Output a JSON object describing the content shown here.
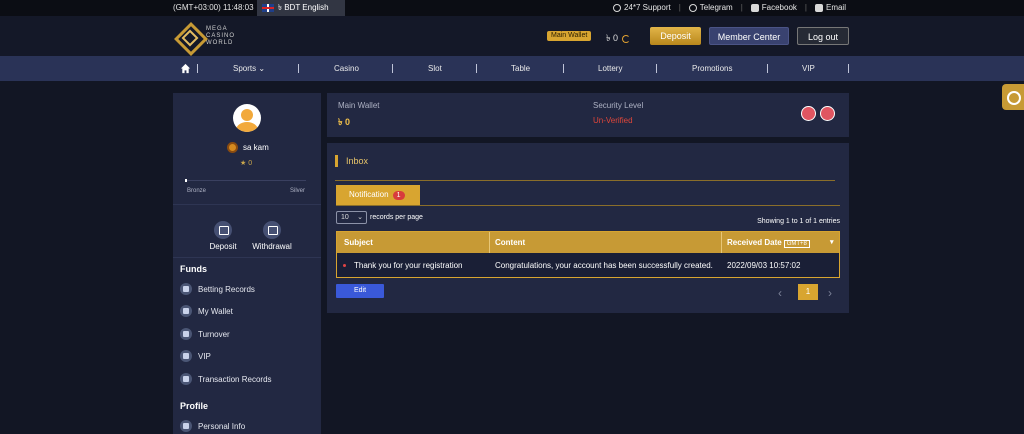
{
  "topbar": {
    "time": "(GMT+03:00) 11:48:03",
    "language": "৳ BDT English",
    "support": "24*7 Support",
    "telegram": "Telegram",
    "facebook": "Facebook",
    "email": "Email"
  },
  "header": {
    "logo_text": "MEGA CASINO WORLD",
    "wallet_label": "Main Wallet",
    "wallet_amount": "৳ 0",
    "deposit": "Deposit",
    "member_center": "Member Center",
    "logout": "Log out"
  },
  "nav": {
    "items": [
      "Sports",
      "Casino",
      "Slot",
      "Table",
      "Lottery",
      "Promotions",
      "VIP"
    ]
  },
  "sidebar": {
    "username": "sa kam",
    "vip_level": "★ 0",
    "level_from": "Bronze",
    "level_to": "Silver",
    "progress": 0.02,
    "deposit": "Deposit",
    "withdrawal": "Withdrawal",
    "funds_title": "Funds",
    "funds_items": [
      "Betting Records",
      "My Wallet",
      "Turnover",
      "VIP",
      "Transaction Records"
    ],
    "profile_title": "Profile",
    "profile_items": [
      "Personal Info"
    ]
  },
  "wallet_card": {
    "main_wallet_label": "Main Wallet",
    "main_wallet_value": "৳ 0",
    "security_label": "Security Level",
    "security_value": "Un-Verified"
  },
  "inbox": {
    "title": "Inbox",
    "tab_label": "Notification",
    "tab_count": "1",
    "rpp_value": "10",
    "rpp_label": "records per page",
    "entries_text": "Showing 1 to 1 of 1 entries",
    "columns": {
      "subject": "Subject",
      "content": "Content",
      "received": "Received Date",
      "gmt": "GMT+8"
    },
    "rows": [
      {
        "subject": "Thank you for your registration",
        "content": "Congratulations, your account has been successfully created.",
        "date": "2022/09/03 10:57:02"
      }
    ],
    "edit_label": "Edit",
    "page_current": "1"
  }
}
